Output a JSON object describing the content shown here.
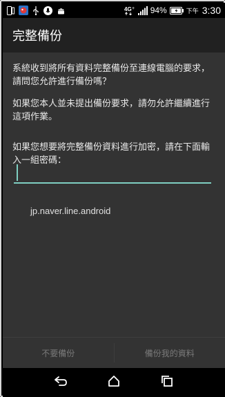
{
  "status_bar": {
    "battery_percent": "94%",
    "time_prefix": "下午",
    "time": "3:30",
    "network_label": "4G",
    "icons": [
      "phone-icon",
      "app-icon",
      "usb-icon",
      "microphone-icon",
      "android-icon",
      "network-icon",
      "signal-icon",
      "battery-icon"
    ]
  },
  "dialog": {
    "title": "完整備份",
    "paragraph_1": "系統收到將所有資料完整備份至連線電腦的要求，請問您允許進行備份嗎？",
    "paragraph_2": "如果您本人並未提出備份要求，請勿允許繼續進行這項作業。",
    "paragraph_3": "如果您想要將完整備份資料進行加密，請在下面輸入一組密碼：",
    "password_value": "",
    "package_name": "jp.naver.line.android",
    "buttons": {
      "deny": "不要備份",
      "allow": "備份我的資料"
    }
  },
  "nav_bar": {
    "icons": [
      "back-icon",
      "home-icon",
      "recents-icon"
    ]
  },
  "colors": {
    "accent": "#7fd0c2",
    "titlebar": "#212121",
    "surface": "#333333",
    "button_text_disabled": "#7a7a7a"
  }
}
